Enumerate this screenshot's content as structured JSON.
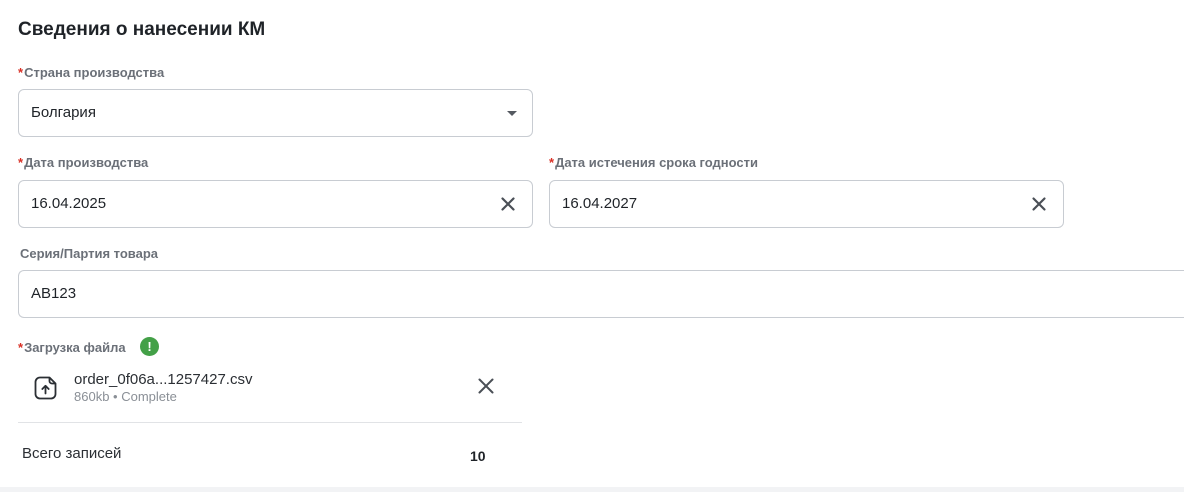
{
  "section": {
    "title": "Сведения о нанесении КМ"
  },
  "required_mark": "*",
  "country": {
    "label": "Страна производства",
    "value": "Болгария"
  },
  "production_date": {
    "label": "Дата производства",
    "value": "16.04.2025"
  },
  "expiry_date": {
    "label": "Дата истечения срока годности",
    "value": "16.04.2027"
  },
  "batch": {
    "label": "Серия/Партия товара",
    "value": "AB123"
  },
  "upload": {
    "label": "Загрузка файла",
    "status_icon": "!",
    "status_color": "#43a047",
    "file": {
      "name": "order_0f06a...1257427.csv",
      "meta": "860kb • Complete"
    }
  },
  "summary": {
    "total_label": "Всего записей",
    "total_value": "10"
  },
  "icons": {
    "dropdown": "chevron-down-icon",
    "clear": "close-icon",
    "file": "file-upload-icon",
    "info": "exclamation-icon"
  }
}
